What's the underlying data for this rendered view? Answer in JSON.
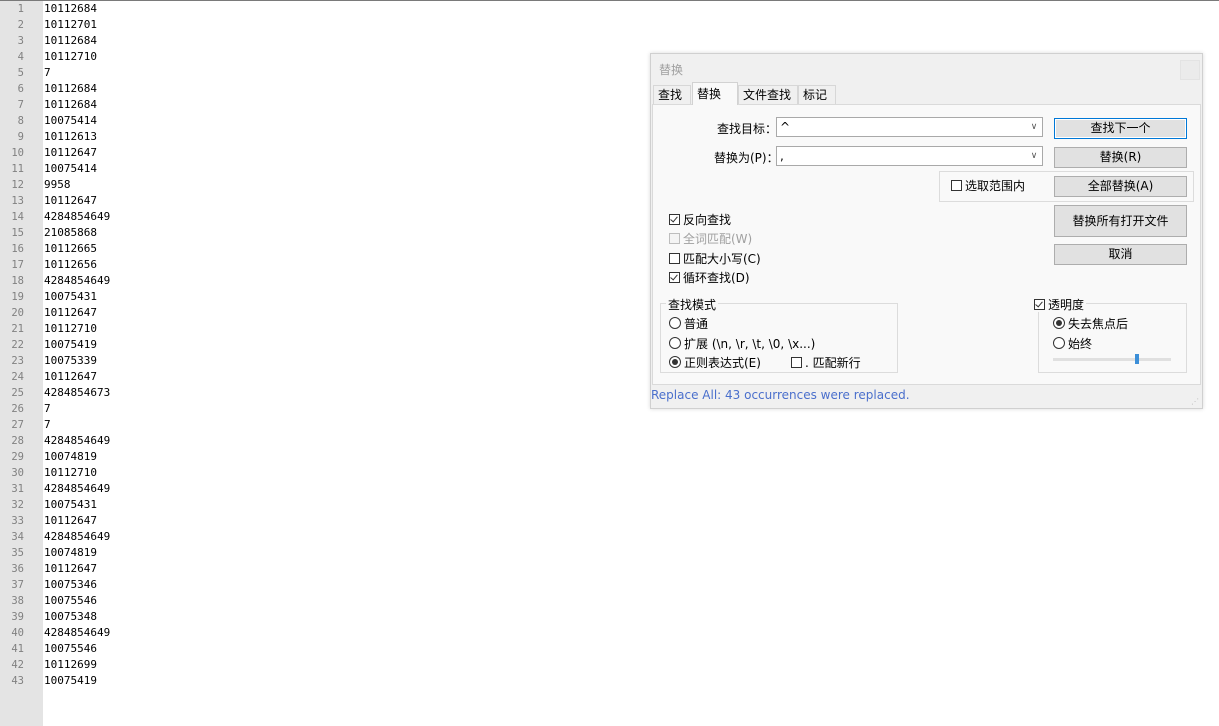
{
  "editor": {
    "lines": [
      {
        "num": "1",
        "text": "10112684"
      },
      {
        "num": "2",
        "text": "10112701"
      },
      {
        "num": "3",
        "text": "10112684"
      },
      {
        "num": "4",
        "text": "10112710"
      },
      {
        "num": "5",
        "text": "7"
      },
      {
        "num": "6",
        "text": "10112684"
      },
      {
        "num": "7",
        "text": "10112684"
      },
      {
        "num": "8",
        "text": "10075414"
      },
      {
        "num": "9",
        "text": "10112613"
      },
      {
        "num": "10",
        "text": "10112647"
      },
      {
        "num": "11",
        "text": "10075414"
      },
      {
        "num": "12",
        "text": "9958"
      },
      {
        "num": "13",
        "text": "10112647"
      },
      {
        "num": "14",
        "text": "4284854649"
      },
      {
        "num": "15",
        "text": "21085868"
      },
      {
        "num": "16",
        "text": "10112665"
      },
      {
        "num": "17",
        "text": "10112656"
      },
      {
        "num": "18",
        "text": "4284854649"
      },
      {
        "num": "19",
        "text": "10075431"
      },
      {
        "num": "20",
        "text": "10112647"
      },
      {
        "num": "21",
        "text": "10112710"
      },
      {
        "num": "22",
        "text": "10075419"
      },
      {
        "num": "23",
        "text": "10075339"
      },
      {
        "num": "24",
        "text": "10112647"
      },
      {
        "num": "25",
        "text": "4284854673"
      },
      {
        "num": "26",
        "text": "7"
      },
      {
        "num": "27",
        "text": "7"
      },
      {
        "num": "28",
        "text": "4284854649"
      },
      {
        "num": "29",
        "text": "10074819"
      },
      {
        "num": "30",
        "text": "10112710"
      },
      {
        "num": "31",
        "text": "4284854649"
      },
      {
        "num": "32",
        "text": "10075431"
      },
      {
        "num": "33",
        "text": "10112647"
      },
      {
        "num": "34",
        "text": "4284854649"
      },
      {
        "num": "35",
        "text": "10074819"
      },
      {
        "num": "36",
        "text": "10112647"
      },
      {
        "num": "37",
        "text": "10075346"
      },
      {
        "num": "38",
        "text": "10075546"
      },
      {
        "num": "39",
        "text": "10075348"
      },
      {
        "num": "40",
        "text": "4284854649"
      },
      {
        "num": "41",
        "text": "10075546"
      },
      {
        "num": "42",
        "text": "10112699"
      },
      {
        "num": "43",
        "text": "10075419"
      }
    ]
  },
  "dialog": {
    "title": "替换",
    "tabs": [
      "查找",
      "替换",
      "文件查找",
      "标记"
    ],
    "active_tab": "替换",
    "find_label": "查找目标：",
    "find_value": "^",
    "replace_label": "替换为(P)：",
    "replace_value": ",",
    "buttons": {
      "find_next": "查找下一个",
      "replace": "替换(R)",
      "replace_all": "全部替换(A)",
      "replace_all_open": "替换所有打开文件",
      "cancel": "取消"
    },
    "in_selection": {
      "label": "选取范围内",
      "checked": false
    },
    "options": [
      {
        "label": "反向查找",
        "checked": true,
        "disabled": false
      },
      {
        "label": "全词匹配(W)",
        "checked": false,
        "disabled": true
      },
      {
        "label": "匹配大小写(C)",
        "checked": false,
        "disabled": false
      },
      {
        "label": "循环查找(D)",
        "checked": true,
        "disabled": false
      }
    ],
    "search_mode": {
      "title": "查找模式",
      "normal": "普通",
      "extended": "扩展 (\\n, \\r, \\t, \\0, \\x...)",
      "regex": "正则表达式(E)",
      "selected": "regex",
      "dot_newline": ". 匹配新行"
    },
    "transparency": {
      "label": "透明度",
      "checked": true,
      "on_lose_focus": "失去焦点后",
      "always": "始终",
      "selected": "on_lose_focus",
      "level": 0.72
    },
    "status": "Replace All: 43 occurrences were replaced."
  }
}
